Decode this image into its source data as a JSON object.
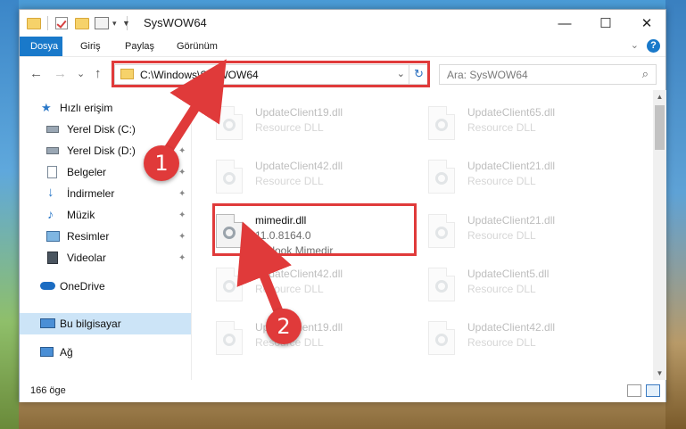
{
  "window": {
    "title": "SysWOW64",
    "min_label": "—",
    "max_label": "☐",
    "close_label": "✕"
  },
  "ribbon": {
    "tabs": [
      "Dosya",
      "Giriş",
      "Paylaş",
      "Görünüm"
    ],
    "collapse_icon": "⌄",
    "help_label": "?"
  },
  "address": {
    "path": "C:\\Windows\\SysWOW64",
    "dropdown_icon": "⌄",
    "refresh_icon": "↻",
    "back_icon": "←",
    "forward_icon": "→",
    "recent_icon": "⌄",
    "up_icon": "↑"
  },
  "search": {
    "placeholder": "Ara: SysWOW64",
    "icon": "⌕"
  },
  "sidebar": {
    "items": [
      {
        "label": "Hızlı erişim",
        "icon": "star-icon",
        "pinned": false
      },
      {
        "label": "Yerel Disk (C:)",
        "icon": "drive-icon",
        "pinned": false
      },
      {
        "label": "Yerel Disk (D:)",
        "icon": "drive-icon",
        "pinned": true
      },
      {
        "label": "Belgeler",
        "icon": "documents-icon",
        "pinned": true
      },
      {
        "label": "İndirmeler",
        "icon": "downloads-icon",
        "pinned": true
      },
      {
        "label": "Müzik",
        "icon": "music-icon",
        "pinned": true
      },
      {
        "label": "Resimler",
        "icon": "pictures-icon",
        "pinned": true
      },
      {
        "label": "Videolar",
        "icon": "videos-icon",
        "pinned": true
      },
      {
        "label": "OneDrive",
        "icon": "onedrive-icon",
        "pinned": false
      },
      {
        "label": "Bu bilgisayar",
        "icon": "computer-icon",
        "pinned": false
      },
      {
        "label": "Ağ",
        "icon": "network-icon",
        "pinned": false
      }
    ],
    "pin_glyph": "📌"
  },
  "files": [
    {
      "name": "UpdateClient19.dll",
      "line1": "Resource DLL",
      "line2": "",
      "highlighted": false
    },
    {
      "name": "UpdateClient65.dll",
      "line1": "Resource DLL",
      "line2": "",
      "highlighted": false
    },
    {
      "name": "UpdateClient42.dll",
      "line1": "Resource DLL",
      "line2": "",
      "highlighted": false
    },
    {
      "name": "UpdateClient21.dll",
      "line1": "Resource DLL",
      "line2": "",
      "highlighted": false
    },
    {
      "name": "mimedir.dll",
      "line1": "11.0.8164.0",
      "line2": "Outlook Mimedir",
      "highlighted": true
    },
    {
      "name": "UpdateClient21.dll",
      "line1": "Resource DLL",
      "line2": "",
      "highlighted": false
    },
    {
      "name": "UpdateClient42.dll",
      "line1": "Resource DLL",
      "line2": "",
      "highlighted": false
    },
    {
      "name": "UpdateClient5.dll",
      "line1": "Resource DLL",
      "line2": "",
      "highlighted": false
    },
    {
      "name": "UpdateClient19.dll",
      "line1": "Resource DLL",
      "line2": "",
      "highlighted": false
    },
    {
      "name": "UpdateClient42.dll",
      "line1": "Resource DLL",
      "line2": "",
      "highlighted": false
    }
  ],
  "status": {
    "item_count": "166 öge"
  },
  "annotations": {
    "badge1": "1",
    "badge2": "2",
    "color": "#e03a3a"
  },
  "colors": {
    "accent": "#1979ca",
    "selection": "#cce4f7",
    "highlight": "#e03a3a"
  }
}
